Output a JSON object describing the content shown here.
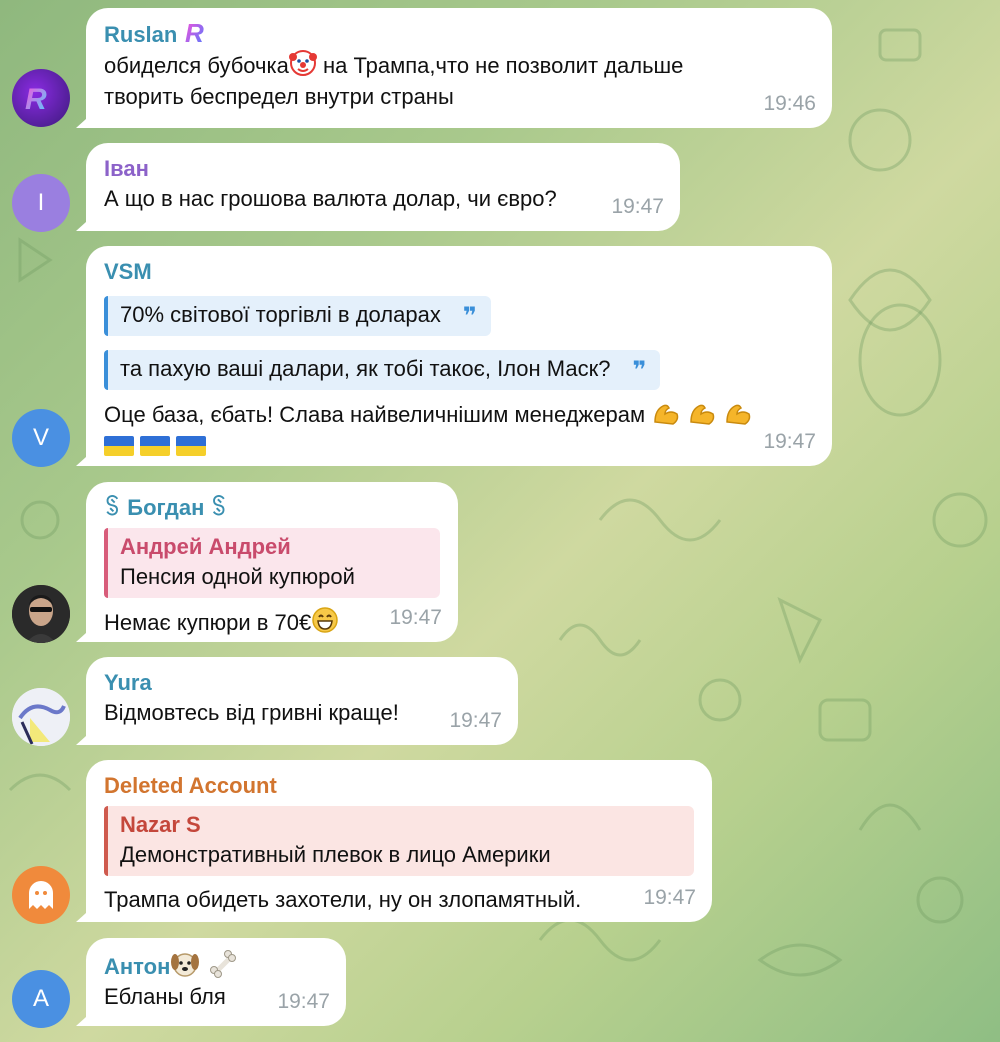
{
  "messages": [
    {
      "sender": "Ruslan",
      "sender_badge": "R",
      "text_part1": "обиделся бубочка",
      "text_part2": " на Трампа,что не позволит дальше",
      "text_line2": "творить беспредел внутри страны",
      "time": "19:46",
      "emoji": "clown-face",
      "avatar_letter": "R",
      "sender_color": "#3a8fb0"
    },
    {
      "sender": "Іван",
      "text": "А що в нас грошова валюта долар, чи євро?",
      "time": "19:47",
      "avatar_letter": "І",
      "avatar_color": "#9a7fe0",
      "sender_color": "#8c62c9"
    },
    {
      "sender": "VSM",
      "quote1": "70% світової торгівлі в доларах",
      "quote2": "та пахую ваші далари, як тобі такоє, Ілон Маск?",
      "quote_mark": "❞",
      "text": "Оце база, єбать! Слава найвеличнішим менеджерам ",
      "emoji": "flexed-biceps ×3",
      "flags": "ukraine-flag ×3",
      "time": "19:47",
      "avatar_letter": "V",
      "avatar_color": "#4a90e2",
      "sender_color": "#3a8fb0"
    },
    {
      "sender": "ꌗ Богдан ꌗ",
      "reply_author": "Андрей Андрей",
      "reply_text": "Пенсия одной купюрой",
      "text": "Немає купюри в 70€",
      "emoji": "grinning-face",
      "time": "19:47",
      "sender_color": "#3a8fb0"
    },
    {
      "sender": "Yura",
      "text": "Відмовтесь від гривні краще!",
      "time": "19:47",
      "sender_color": "#3a8fb0"
    },
    {
      "sender": "Deleted Account",
      "reply_author": "Nazar S",
      "reply_text": "Демонстративный плевок в лицо Америки",
      "text": "Трампа обидеть захотели, ну он злопамятный.",
      "time": "19:47",
      "avatar_icon": "ghost-icon",
      "avatar_color": "#f08a3c",
      "sender_color": "#d2752f"
    },
    {
      "sender": "Антон",
      "sender_emoji": "dog-face bone",
      "text": "Ебланы бля",
      "time": "19:47",
      "avatar_letter": "А",
      "avatar_color": "#4a90e2",
      "sender_color": "#3a8fb0"
    }
  ]
}
